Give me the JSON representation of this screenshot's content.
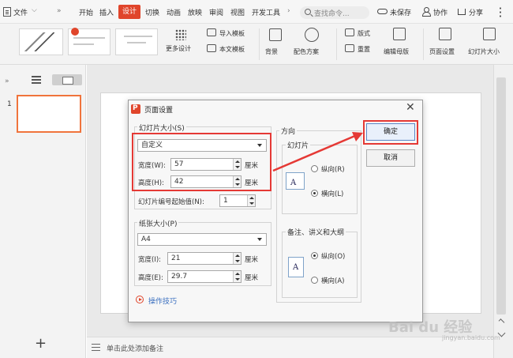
{
  "menubar": {
    "file": "文件",
    "tabs": [
      "开始",
      "插入",
      "设计",
      "切换",
      "动画",
      "放映",
      "审阅",
      "视图",
      "开发工具"
    ],
    "active_tab": "设计",
    "more": "»",
    "search_placeholder": "查找命令...",
    "unsaved": "未保存",
    "collab": "协作",
    "share": "分享"
  },
  "ribbon": {
    "template_badge": "",
    "more_design": "更多设计",
    "import_template": "导入模板",
    "this_template": "本文模板",
    "background": "背景",
    "color_scheme": "配色方案",
    "layout": "版式",
    "reset": "重置",
    "edit_master": "编辑母版",
    "page_setup": "页面设置",
    "slide_size": "幻灯片大小"
  },
  "left_pane": {
    "slide_number": "1",
    "collapse": "»",
    "add": "+"
  },
  "notes": {
    "placeholder": "单击此处添加备注"
  },
  "dialog": {
    "title": "页面设置",
    "close": "✕",
    "slide_size_group": "幻灯片大小(S)",
    "slide_size_value": "自定义",
    "width_label": "宽度(W):",
    "width_value": "57",
    "height_label": "高度(H):",
    "height_value": "42",
    "unit": "厘米",
    "start_number_label": "幻灯片编号起始值(N):",
    "start_number_value": "1",
    "paper_group": "纸张大小(P)",
    "paper_value": "A4",
    "paper_width_label": "宽度(I):",
    "paper_width_value": "21",
    "paper_height_label": "高度(E):",
    "paper_height_value": "29.7",
    "orientation_group": "方向",
    "slides_sub": "幻灯片",
    "portrait_r": "纵向(R)",
    "landscape_l": "横向(L)",
    "notes_sub": "备注、讲义和大纲",
    "portrait_o": "纵向(O)",
    "landscape_a": "横向(A)",
    "ok": "确定",
    "cancel": "取消",
    "tips": "操作技巧"
  },
  "watermark": {
    "brand": "Bai du 经验",
    "url": "jingyan.baidu.com"
  },
  "colors": {
    "accent": "#e0452b",
    "highlight": "#e53935",
    "link": "#3a6fbf"
  }
}
